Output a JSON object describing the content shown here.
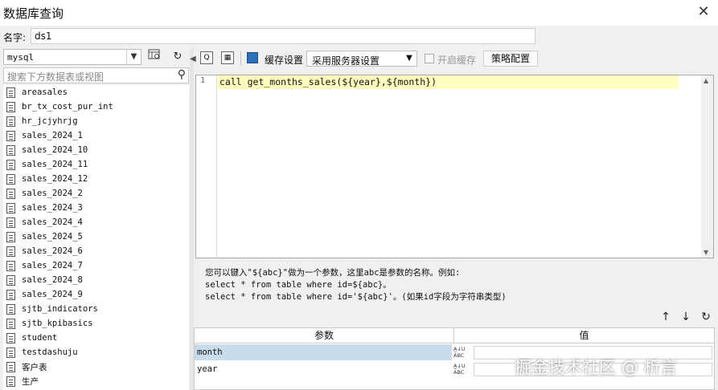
{
  "window": {
    "title": "数据库查询",
    "close_glyph": "✕"
  },
  "name_field": {
    "label": "名字:",
    "value": "ds1"
  },
  "left": {
    "database": "mysql",
    "search_placeholder": "搜索下方数据表或视图",
    "tables": [
      "areasales",
      "br_tx_cost_pur_int",
      "hr_jcjyhrjg",
      "sales_2024_1",
      "sales_2024_10",
      "sales_2024_11",
      "sales_2024_12",
      "sales_2024_2",
      "sales_2024_3",
      "sales_2024_4",
      "sales_2024_5",
      "sales_2024_6",
      "sales_2024_7",
      "sales_2024_8",
      "sales_2024_9",
      "sjtb_indicators",
      "sjtb_kpibasics",
      "student",
      "testdashuju",
      "客户表",
      "生产"
    ]
  },
  "toolbar": {
    "cache_label": "缓存设置",
    "cache_mode": "采用服务器设置",
    "enable_cache_label": "开启缓存",
    "strategy_label": "策略配置"
  },
  "editor": {
    "line_number": "1",
    "code": "call get_months_sales(${year},${month})"
  },
  "hints": {
    "line1": "您可以键入\"${abc}\"做为一个参数，这里abc是参数的名称。例如:",
    "line2": "select * from table where id=${abc}。",
    "line3": "select * from table where id='${abc}'。(如果id字段为字符串类型)"
  },
  "params": {
    "col_param": "参数",
    "col_value": "值",
    "rows": [
      {
        "name": "month",
        "type": "ABC",
        "value": ""
      },
      {
        "name": "year",
        "type": "ABC",
        "value": ""
      }
    ]
  },
  "watermark": "掘金技术社区 @ 析言"
}
